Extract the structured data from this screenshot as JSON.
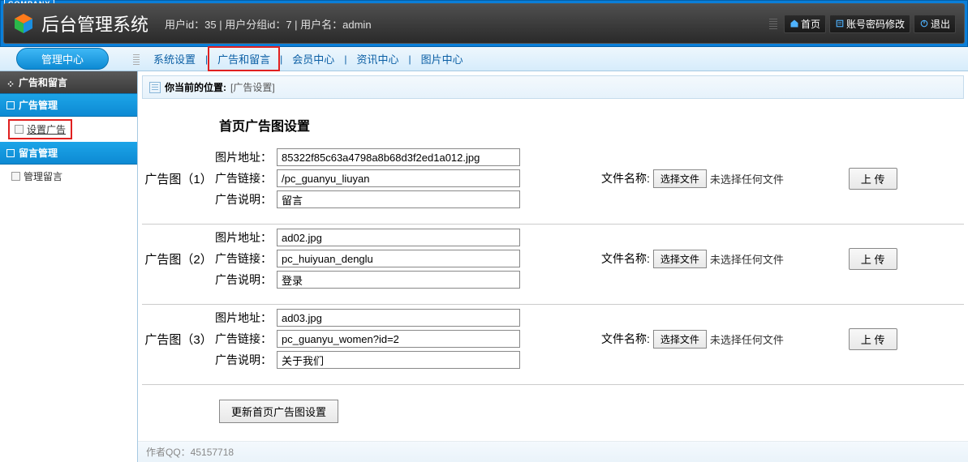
{
  "header": {
    "company_badge": "COMPANY",
    "system_title": "后台管理系统",
    "user_info": "用户id：35 | 用户分组id：7 | 用户名：admin",
    "home_btn": "首页",
    "pwd_btn": "账号密码修改",
    "logout_btn": "退出"
  },
  "topnav": {
    "center": "管理中心",
    "items": [
      "系统设置",
      "广告和留言",
      "会员中心",
      "资讯中心",
      "图片中心"
    ],
    "highlighted_index": 1
  },
  "sidebar": {
    "section1_title": "广告和留言",
    "group1_title": "广告管理",
    "group1_items": [
      "设置广告"
    ],
    "group1_highlight_index": 0,
    "group2_title": "留言管理",
    "group2_items": [
      "管理留言"
    ]
  },
  "breadcrumb": {
    "label": "你当前的位置:",
    "path": "[广告设置]"
  },
  "form": {
    "title": "首页广告图设置",
    "img_addr_label": "图片地址：",
    "ad_link_label": "广告链接：",
    "ad_desc_label": "广告说明：",
    "file_label": "文件名称:",
    "file_btn": "选择文件",
    "no_file": "未选择任何文件",
    "upload_btn": "上 传",
    "groups": [
      {
        "name": "广告图（1）",
        "img": "85322f85c63a4798a8b68d3f2ed1a012.jpg",
        "link": "/pc_guanyu_liuyan",
        "desc": "留言"
      },
      {
        "name": "广告图（2）",
        "img": "ad02.jpg",
        "link": "pc_huiyuan_denglu",
        "desc": "登录"
      },
      {
        "name": "广告图（3）",
        "img": "ad03.jpg",
        "link": "pc_guanyu_women?id=2",
        "desc": "关于我们"
      }
    ],
    "submit_btn": "更新首页广告图设置"
  },
  "footer": {
    "text": "作者QQ：45157718"
  }
}
